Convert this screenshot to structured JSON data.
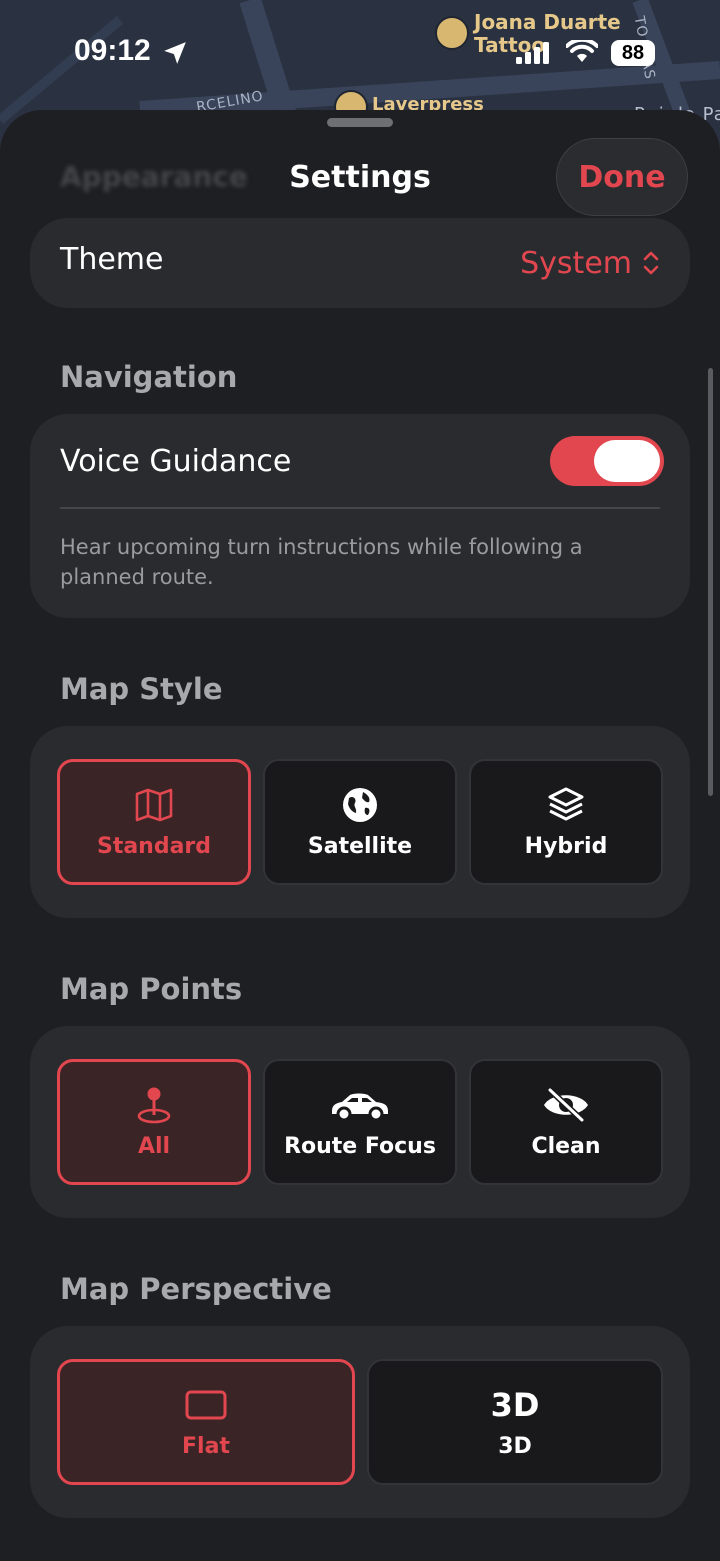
{
  "status_bar": {
    "time": "09:12",
    "battery": "88"
  },
  "map": {
    "poi_1": "Joana Duarte",
    "poi_1_line2": "Tattoo",
    "poi_2": "Laverpress",
    "street_1": "RCELINO",
    "street_2": "TO DIAS",
    "street_3": "Rei do Pa"
  },
  "sheet": {
    "ghost_title": "Appearance",
    "title": "Settings",
    "done_label": "Done"
  },
  "appearance": {
    "theme_label": "Theme",
    "theme_value": "System"
  },
  "navigation": {
    "header": "Navigation",
    "voice_label": "Voice Guidance",
    "voice_enabled": true,
    "voice_hint": "Hear upcoming turn instructions while following a planned route."
  },
  "map_style": {
    "header": "Map Style",
    "options": [
      {
        "label": "Standard",
        "icon": "map-icon",
        "selected": true
      },
      {
        "label": "Satellite",
        "icon": "globe-icon",
        "selected": false
      },
      {
        "label": "Hybrid",
        "icon": "layers-icon",
        "selected": false
      }
    ]
  },
  "map_points": {
    "header": "Map Points",
    "options": [
      {
        "label": "All",
        "icon": "map-pin-icon",
        "selected": true
      },
      {
        "label": "Route Focus",
        "icon": "car-icon",
        "selected": false
      },
      {
        "label": "Clean",
        "icon": "eye-slash-icon",
        "selected": false
      }
    ]
  },
  "map_perspective": {
    "header": "Map Perspective",
    "options": [
      {
        "label": "Flat",
        "icon": "rectangle-icon",
        "selected": true
      },
      {
        "label": "3D",
        "icon_text": "3D",
        "selected": false
      }
    ]
  },
  "colors": {
    "accent": "#e2474f",
    "sheet": "#1e1f22",
    "card": "#2a2b2f"
  }
}
